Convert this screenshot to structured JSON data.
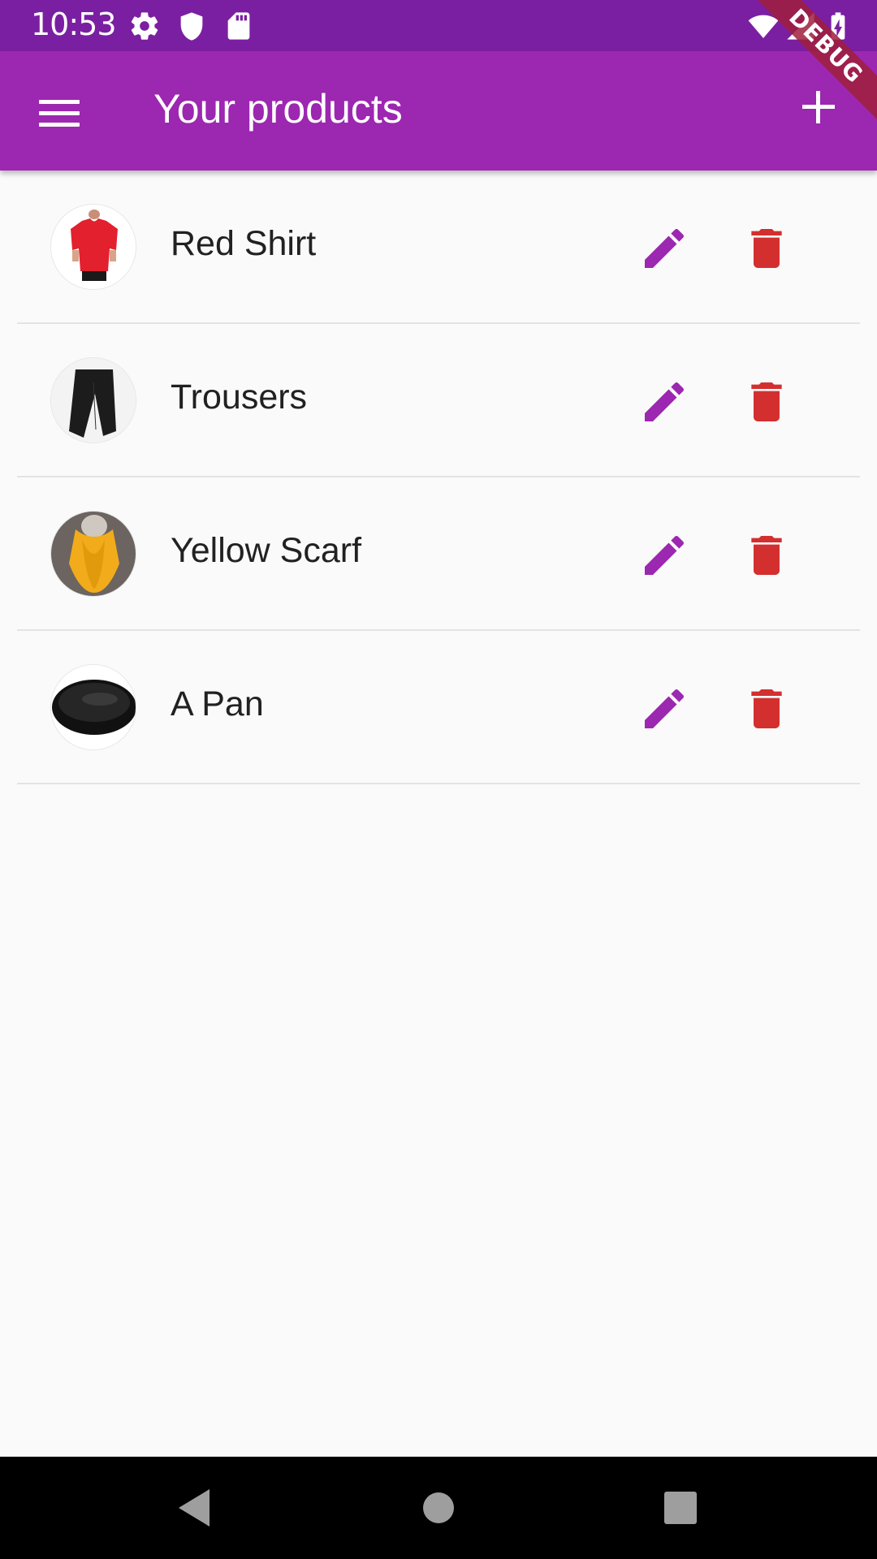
{
  "status_bar": {
    "time": "10:53",
    "icons": [
      "gear-icon",
      "shield-icon",
      "sd-card-icon",
      "wifi-icon",
      "signal-icon",
      "battery-charging-icon"
    ]
  },
  "debug_banner": "DEBUG",
  "app_bar": {
    "menu_icon": "menu-icon",
    "title": "Your products",
    "add_icon": "add-icon",
    "background": "#9c27b0",
    "status_background": "#7b1fa2"
  },
  "products": [
    {
      "title": "Red Shirt",
      "thumbnail": "red-shirt"
    },
    {
      "title": "Trousers",
      "thumbnail": "trousers"
    },
    {
      "title": "Yellow Scarf",
      "thumbnail": "yellow-scarf"
    },
    {
      "title": "A Pan",
      "thumbnail": "pan"
    }
  ],
  "actions": {
    "edit_icon": "pencil-icon",
    "edit_color": "#9c27b0",
    "delete_icon": "trash-icon",
    "delete_color": "#d32f2f"
  },
  "nav_bar": {
    "buttons": [
      "back-icon",
      "home-icon",
      "recents-icon"
    ]
  }
}
